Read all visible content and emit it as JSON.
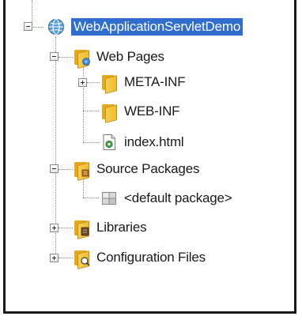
{
  "tree": {
    "root": {
      "label": "WebApplicationServletDemo",
      "icon": "globe-icon",
      "expanded": true,
      "selected": true
    },
    "web_pages": {
      "label": "Web Pages",
      "icon": "web-pages-folder-icon",
      "expanded": true,
      "children": [
        {
          "label": "META-INF",
          "icon": "folder-icon",
          "expanded": false
        },
        {
          "label": "WEB-INF",
          "icon": "folder-icon"
        },
        {
          "label": "index.html",
          "icon": "html-file-icon"
        }
      ]
    },
    "source_packages": {
      "label": "Source Packages",
      "icon": "source-packages-folder-icon",
      "expanded": true,
      "children": [
        {
          "label": "<default package>",
          "icon": "package-icon"
        }
      ]
    },
    "libraries": {
      "label": "Libraries",
      "icon": "libraries-folder-icon",
      "expanded": false
    },
    "configuration_files": {
      "label": "Configuration Files",
      "icon": "configuration-folder-icon",
      "expanded": false
    }
  },
  "colors": {
    "selection": "#2f6dcf",
    "folder": "#f0bc2d",
    "globe": "#4a90c8"
  }
}
